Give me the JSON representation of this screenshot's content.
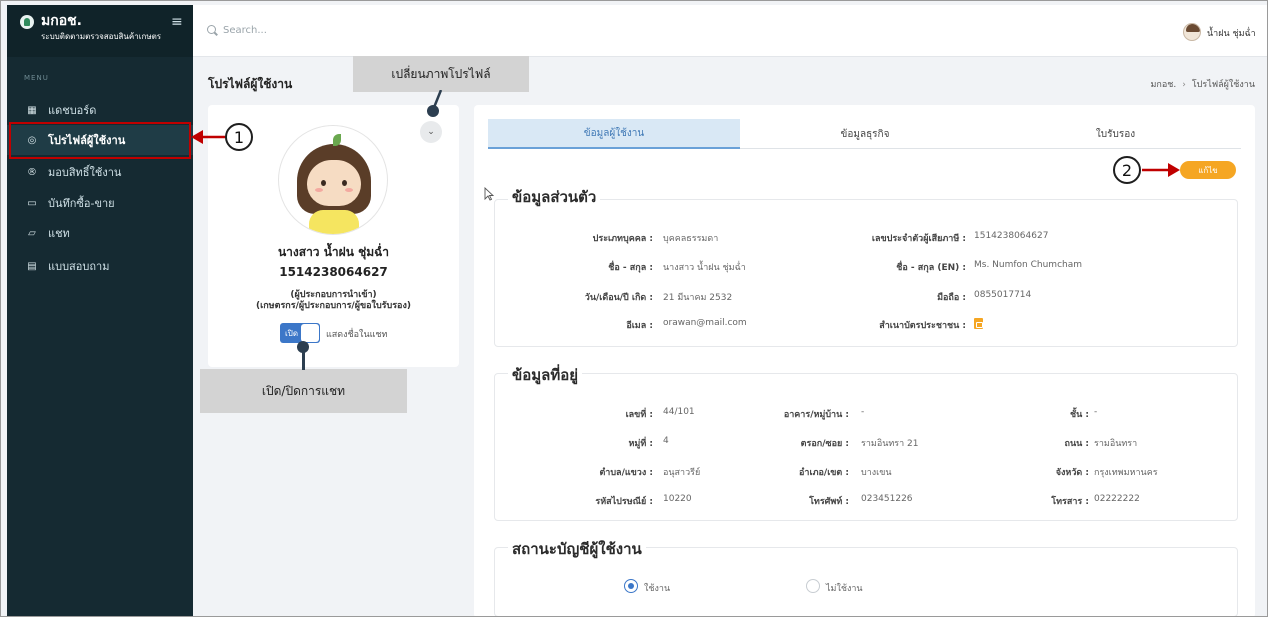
{
  "brand": {
    "title": "มกอช.",
    "subtitle": "ระบบติดตามตรวจสอบสินค้าเกษตร"
  },
  "sidebar": {
    "caption": "MENU",
    "items": [
      {
        "label": "แดชบอร์ด",
        "icon": "dashboard-icon"
      },
      {
        "label": "โปรไฟล์ผู้ใช้งาน",
        "icon": "profile-icon",
        "active": true
      },
      {
        "label": "มอบสิทธิ์ใช้งาน",
        "icon": "registered-icon"
      },
      {
        "label": "บันทึกซื้อ-ขาย",
        "icon": "document-icon"
      },
      {
        "label": "แชท",
        "icon": "chat-icon"
      },
      {
        "label": "แบบสอบถาม",
        "icon": "survey-icon"
      }
    ]
  },
  "topbar": {
    "search_placeholder": "Search...",
    "user_name": "น้ำฝน ชุ่มฉ่ำ"
  },
  "page": {
    "title": "โปรไฟล์ผู้ใช้งาน",
    "breadcrumb": [
      "มกอช.",
      "โปรไฟล์ผู้ใช้งาน"
    ]
  },
  "profile": {
    "name": "นางสาว น้ำฝน ชุ่มฉ่ำ",
    "tax_id": "1514238064627",
    "role_line1": "(ผู้ประกอบการนำเข้า)",
    "role_line2": "(เกษตรกร/ผู้ประกอบการ/ผู้ขอใบรับรอง)",
    "chat_toggle_label": "เปิด",
    "chat_toggle_on": true,
    "chat_label": "แสดงชื่อในแชท"
  },
  "tabs": [
    "ข้อมูลผู้ใช้งาน",
    "ข้อมูลธุรกิจ",
    "ใบรับรอง"
  ],
  "edit_button": "แก้ไข",
  "personal": {
    "title": "ข้อมูลส่วนตัว",
    "fields": [
      {
        "label": "ประเภทบุคคล :",
        "value": "บุคคลธรรมดา"
      },
      {
        "label": "เลขประจำตัวผู้เสียภาษี :",
        "value": "1514238064627"
      },
      {
        "label": "ชื่อ - สกุล :",
        "value": "นางสาว น้ำฝน ชุ่มฉ่ำ"
      },
      {
        "label": "ชื่อ - สกุล (EN) :",
        "value": "Ms. Numfon Chumcham"
      },
      {
        "label": "วัน/เดือน/ปี เกิด :",
        "value": "21 มีนาคม 2532"
      },
      {
        "label": "มือถือ :",
        "value": "0855017714"
      },
      {
        "label": "อีเมล :",
        "value": "orawan@mail.com"
      },
      {
        "label": "สำเนาบัตรประชาชน :",
        "value": "",
        "icon": "pdf-file-icon"
      }
    ]
  },
  "address": {
    "title": "ข้อมูลที่อยู่",
    "fields": [
      {
        "label": "เลขที่ :",
        "value": "44/101"
      },
      {
        "label": "อาคาร/หมู่บ้าน :",
        "value": "-"
      },
      {
        "label": "ชั้น :",
        "value": "-"
      },
      {
        "label": "หมู่ที่ :",
        "value": "4"
      },
      {
        "label": "ตรอก/ซอย :",
        "value": "รามอินทรา 21"
      },
      {
        "label": "ถนน :",
        "value": "รามอินทรา"
      },
      {
        "label": "ตำบล/แขวง :",
        "value": "อนุสาวรีย์"
      },
      {
        "label": "อำเภอ/เขต :",
        "value": "บางเขน"
      },
      {
        "label": "จังหวัด :",
        "value": "กรุงเทพมหานคร"
      },
      {
        "label": "รหัสไปรษณีย์ :",
        "value": "10220"
      },
      {
        "label": "โทรศัพท์ :",
        "value": "023451226"
      },
      {
        "label": "โทรสาร :",
        "value": "02222222"
      }
    ]
  },
  "status": {
    "title": "สถานะบัญชีผู้ใช้งาน",
    "options": [
      {
        "label": "ใช้งาน",
        "checked": true
      },
      {
        "label": "ไม่ใช้งาน",
        "checked": false
      }
    ]
  },
  "annotations": {
    "change_photo": "เปลี่ยนภาพโปรไฟล์",
    "toggle_chat": "เปิด/ปิดการแชท",
    "marker1": "1",
    "marker2": "2",
    "color": "#c00000"
  }
}
